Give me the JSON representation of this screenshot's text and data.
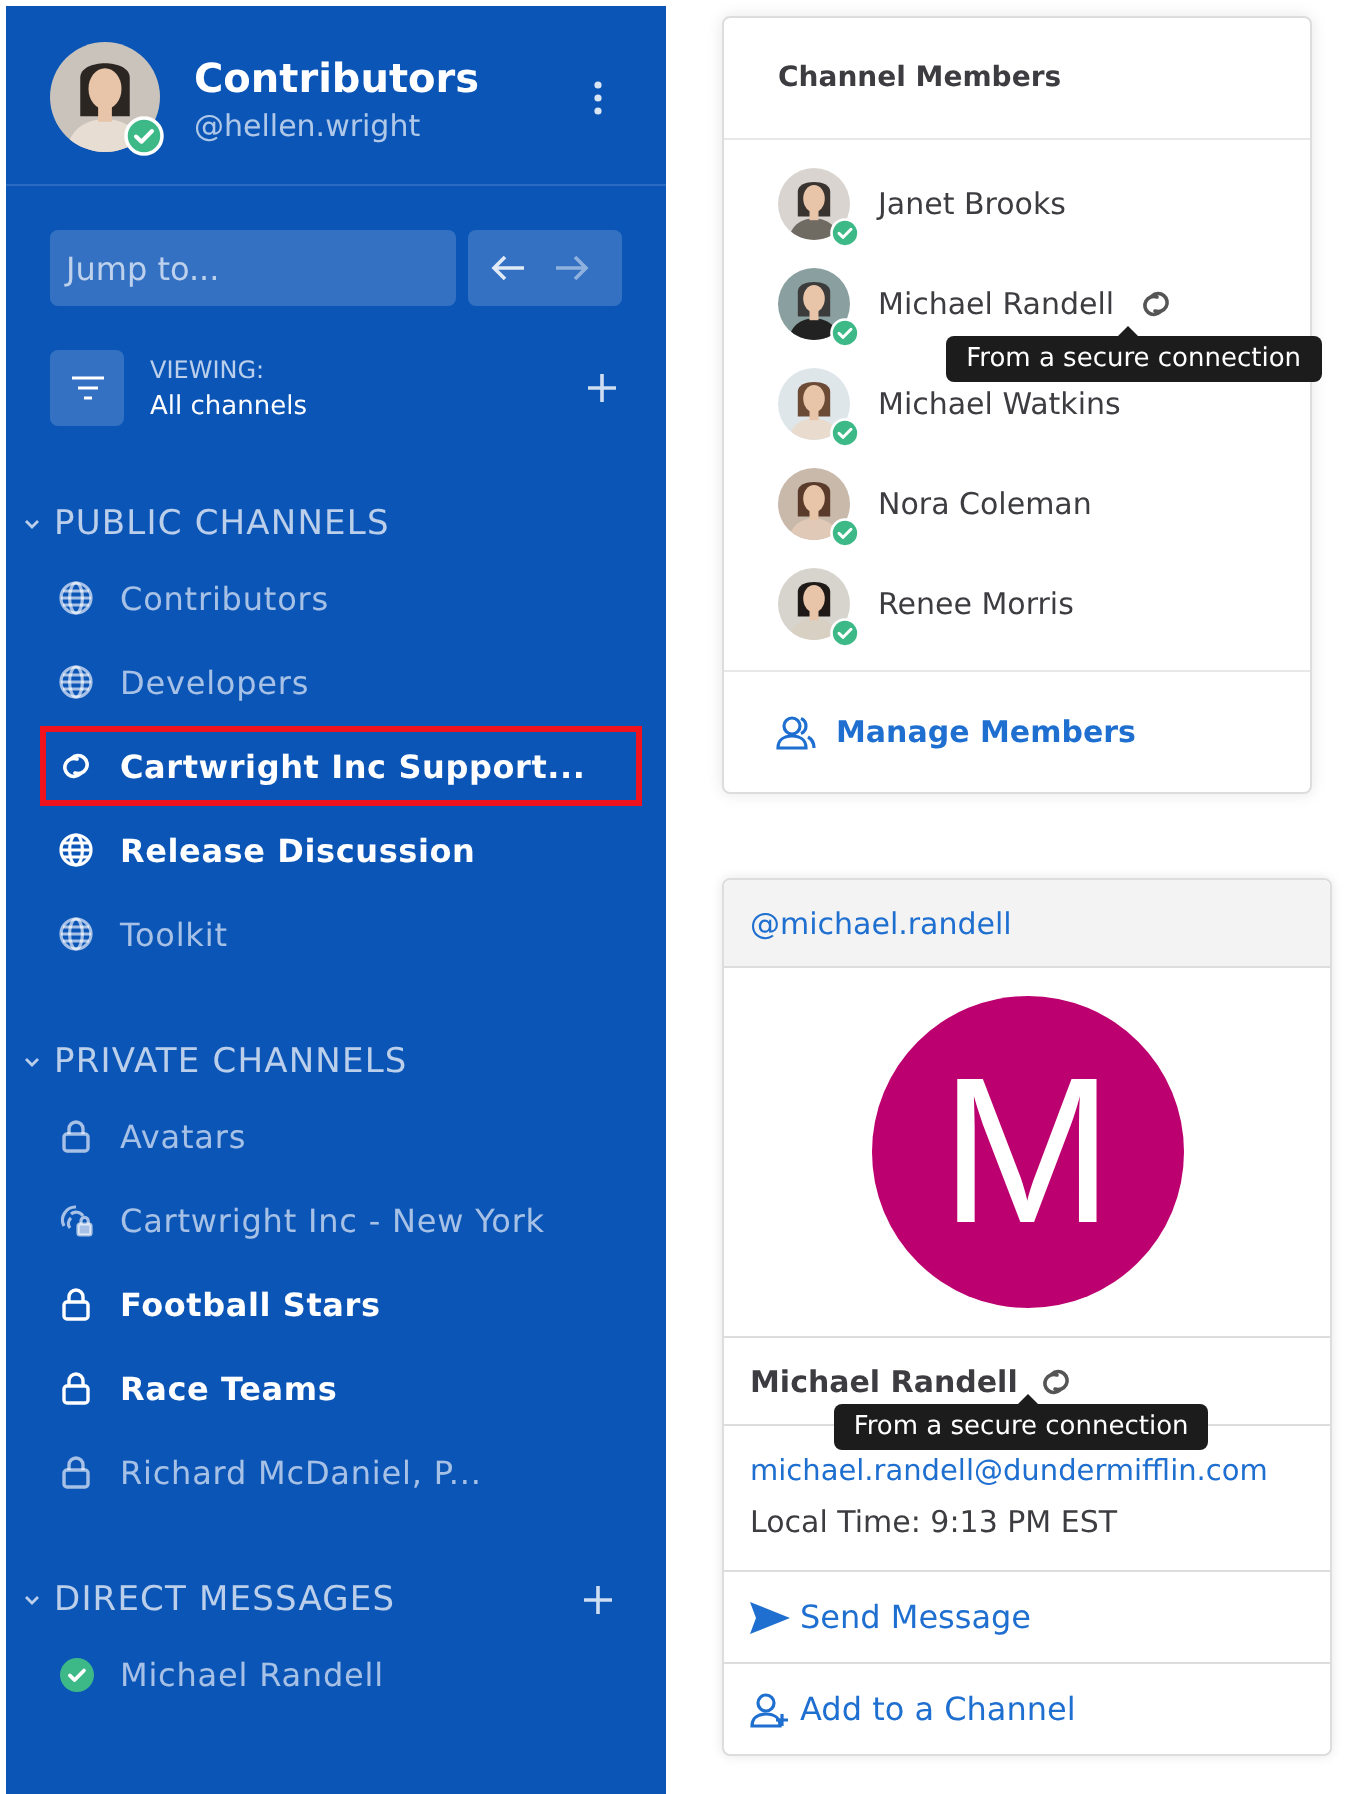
{
  "sidebar": {
    "team_name": "Contributors",
    "username": "@hellen.wright",
    "online": true,
    "search": {
      "placeholder": "Jump to..."
    },
    "filter": {
      "label": "VIEWING:",
      "value": "All channels"
    },
    "sections": [
      {
        "title": "PUBLIC CHANNELS",
        "expanded": true,
        "can_add": false,
        "items": [
          {
            "kind": "public",
            "label": "Contributors",
            "unread": false,
            "highlighted": false
          },
          {
            "kind": "public",
            "label": "Developers",
            "unread": false,
            "highlighted": false
          },
          {
            "kind": "shared",
            "label": "Cartwright Inc Support...",
            "unread": true,
            "highlighted": true
          },
          {
            "kind": "public",
            "label": "Release Discussion",
            "unread": true,
            "highlighted": false
          },
          {
            "kind": "public",
            "label": "Toolkit",
            "unread": false,
            "highlighted": false
          }
        ]
      },
      {
        "title": "PRIVATE CHANNELS",
        "expanded": true,
        "can_add": false,
        "items": [
          {
            "kind": "private",
            "label": "Avatars",
            "unread": false,
            "highlighted": false
          },
          {
            "kind": "private-shared",
            "label": "Cartwright Inc - New York",
            "unread": false,
            "highlighted": false
          },
          {
            "kind": "private",
            "label": "Football Stars",
            "unread": true,
            "highlighted": false
          },
          {
            "kind": "private",
            "label": "Race Teams",
            "unread": true,
            "highlighted": false
          },
          {
            "kind": "private",
            "label": "Richard McDaniel, P...",
            "unread": false,
            "highlighted": false
          }
        ]
      },
      {
        "title": "DIRECT MESSAGES",
        "expanded": true,
        "can_add": true,
        "items": [
          {
            "kind": "direct",
            "label": "Michael Randell",
            "unread": false,
            "highlighted": false
          }
        ]
      }
    ]
  },
  "channel_members": {
    "title": "Channel Members",
    "members": [
      {
        "name": "Janet Brooks",
        "online": true,
        "shared": false
      },
      {
        "name": "Michael Randell",
        "online": true,
        "shared": true,
        "tooltip": "From a secure connection"
      },
      {
        "name": "Michael Watkins",
        "online": true,
        "shared": false
      },
      {
        "name": "Nora Coleman",
        "online": true,
        "shared": false
      },
      {
        "name": "Renee Morris",
        "online": true,
        "shared": false
      }
    ],
    "action": "Manage Members"
  },
  "profile_popover": {
    "username": "@michael.randell",
    "initial": "M",
    "name": "Michael Randell",
    "shared": true,
    "tooltip": "From a secure connection",
    "email": "michael.randell@dundermifflin.com",
    "local_time": "Local Time: 9:13 PM EST",
    "actions": [
      {
        "kind": "send",
        "label": "Send Message"
      },
      {
        "kind": "add",
        "label": "Add to a Channel"
      }
    ]
  }
}
